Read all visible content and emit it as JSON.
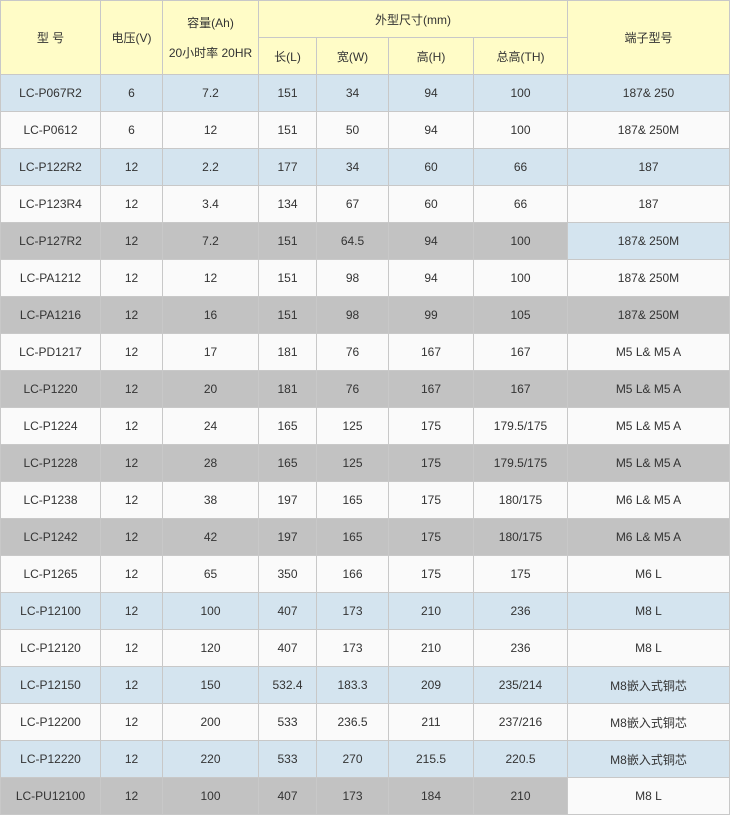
{
  "header": {
    "model": "型 号",
    "voltage": "电压(V)",
    "capacity": "容量(Ah)",
    "capacity_sub": "20小时率 20HR",
    "dimensions": "外型尺寸(mm)",
    "length": "长(L)",
    "width": "宽(W)",
    "height": "高(H)",
    "total_height": "总高(TH)",
    "terminal": "端子型号"
  },
  "rows": [
    {
      "model": "LC-P067R2",
      "voltage": "6",
      "capacity": "7.2",
      "length": "151",
      "width": "34",
      "height": "94",
      "total_height": "100",
      "terminal": "187& 250",
      "style": "blue"
    },
    {
      "model": "LC-P0612",
      "voltage": "6",
      "capacity": "12",
      "length": "151",
      "width": "50",
      "height": "94",
      "total_height": "100",
      "terminal": "187& 250M",
      "style": "white"
    },
    {
      "model": "LC-P122R2",
      "voltage": "12",
      "capacity": "2.2",
      "length": "177",
      "width": "34",
      "height": "60",
      "total_height": "66",
      "terminal": "187",
      "style": "blue"
    },
    {
      "model": "LC-P123R4",
      "voltage": "12",
      "capacity": "3.4",
      "length": "134",
      "width": "67",
      "height": "60",
      "total_height": "66",
      "terminal": "187",
      "style": "white"
    },
    {
      "model": "LC-P127R2",
      "voltage": "12",
      "capacity": "7.2",
      "length": "151",
      "width": "64.5",
      "height": "94",
      "total_height": "100",
      "terminal": "187& 250M",
      "style": "gray-blue"
    },
    {
      "model": "LC-PA1212",
      "voltage": "12",
      "capacity": "12",
      "length": "151",
      "width": "98",
      "height": "94",
      "total_height": "100",
      "terminal": "187& 250M",
      "style": "white"
    },
    {
      "model": "LC-PA1216",
      "voltage": "12",
      "capacity": "16",
      "length": "151",
      "width": "98",
      "height": "99",
      "total_height": "105",
      "terminal": "187& 250M",
      "style": "gray"
    },
    {
      "model": "LC-PD1217",
      "voltage": "12",
      "capacity": "17",
      "length": "181",
      "width": "76",
      "height": "167",
      "total_height": "167",
      "terminal": "M5 L& M5 A",
      "style": "white"
    },
    {
      "model": "LC-P1220",
      "voltage": "12",
      "capacity": "20",
      "length": "181",
      "width": "76",
      "height": "167",
      "total_height": "167",
      "terminal": "M5 L& M5 A",
      "style": "gray"
    },
    {
      "model": "LC-P1224",
      "voltage": "12",
      "capacity": "24",
      "length": "165",
      "width": "125",
      "height": "175",
      "total_height": "179.5/175",
      "terminal": "M5 L& M5 A",
      "style": "white"
    },
    {
      "model": "LC-P1228",
      "voltage": "12",
      "capacity": "28",
      "length": "165",
      "width": "125",
      "height": "175",
      "total_height": "179.5/175",
      "terminal": "M5 L& M5 A",
      "style": "gray"
    },
    {
      "model": "LC-P1238",
      "voltage": "12",
      "capacity": "38",
      "length": "197",
      "width": "165",
      "height": "175",
      "total_height": "180/175",
      "terminal": "M6 L& M5 A",
      "style": "white"
    },
    {
      "model": "LC-P1242",
      "voltage": "12",
      "capacity": "42",
      "length": "197",
      "width": "165",
      "height": "175",
      "total_height": "180/175",
      "terminal": "M6 L& M5 A",
      "style": "gray"
    },
    {
      "model": "LC-P1265",
      "voltage": "12",
      "capacity": "65",
      "length": "350",
      "width": "166",
      "height": "175",
      "total_height": "175",
      "terminal": "M6 L",
      "style": "white"
    },
    {
      "model": "LC-P12100",
      "voltage": "12",
      "capacity": "100",
      "length": "407",
      "width": "173",
      "height": "210",
      "total_height": "236",
      "terminal": "M8 L",
      "style": "blue"
    },
    {
      "model": "LC-P12120",
      "voltage": "12",
      "capacity": "120",
      "length": "407",
      "width": "173",
      "height": "210",
      "total_height": "236",
      "terminal": "M8 L",
      "style": "white"
    },
    {
      "model": "LC-P12150",
      "voltage": "12",
      "capacity": "150",
      "length": "532.4",
      "width": "183.3",
      "height": "209",
      "total_height": "235/214",
      "terminal": "M8嵌入式铜芯",
      "style": "blue"
    },
    {
      "model": "LC-P12200",
      "voltage": "12",
      "capacity": "200",
      "length": "533",
      "width": "236.5",
      "height": "211",
      "total_height": "237/216",
      "terminal": "M8嵌入式铜芯",
      "style": "white"
    },
    {
      "model": "LC-P12220",
      "voltage": "12",
      "capacity": "220",
      "length": "533",
      "width": "270",
      "height": "215.5",
      "total_height": "220.5",
      "terminal": "M8嵌入式铜芯",
      "style": "blue"
    },
    {
      "model": "LC-PU12100",
      "voltage": "12",
      "capacity": "100",
      "length": "407",
      "width": "173",
      "height": "184",
      "total_height": "210",
      "terminal": "M8 L",
      "style": "gray-white"
    }
  ],
  "colors": {
    "header_bg": "#fffcc7",
    "row_blue": "#d4e4ef",
    "row_gray": "#c2c2c2",
    "row_white": "#fafafa",
    "border": "#c8c8c8",
    "text": "#333333"
  }
}
